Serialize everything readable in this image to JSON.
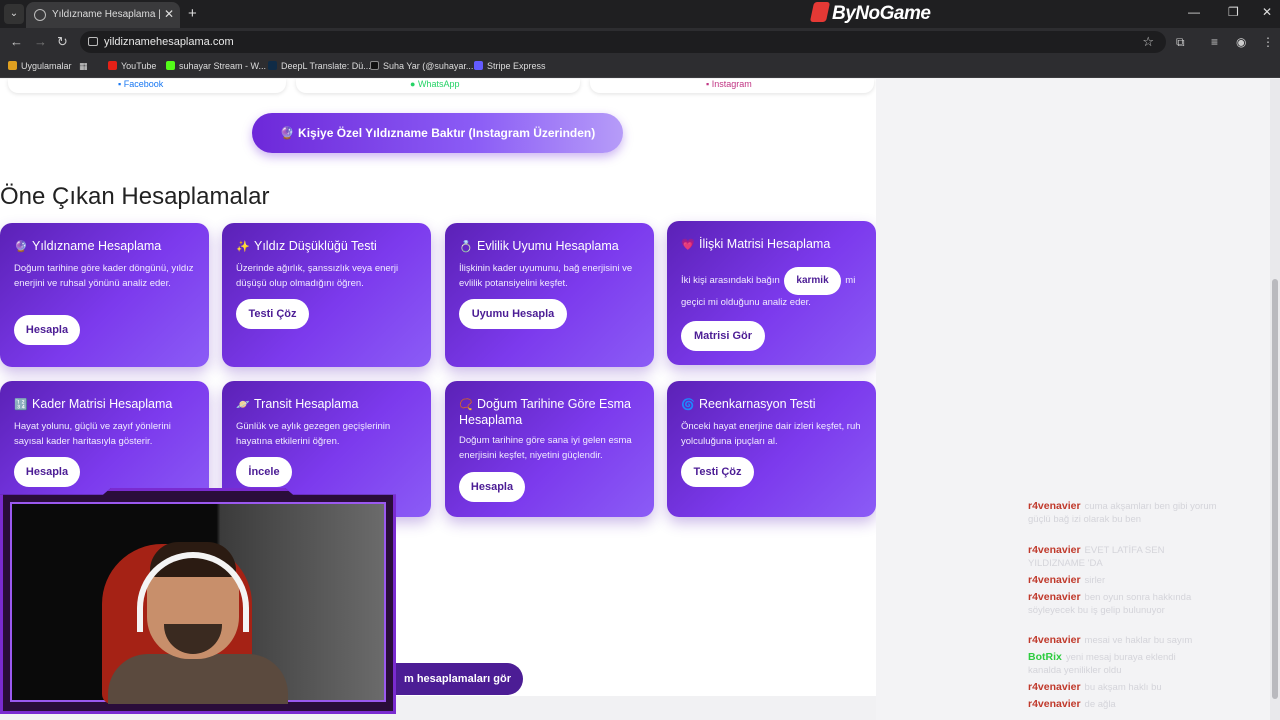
{
  "browser": {
    "tab_title": "Yıldızname Hesaplama | Doğum",
    "tab_close": "✕",
    "new_tab": "+",
    "brand": "ByNoGame",
    "url": "yildiznamehesaplama.com",
    "bookmarks": [
      {
        "label": "Uygulamalar",
        "color": "#e0a020"
      },
      {
        "label": "YouTube",
        "color": "#e62117"
      },
      {
        "label": "suhayar Stream - W...",
        "color": "#53fc18"
      },
      {
        "label": "DeepL Translate: Dü...",
        "color": "#0f2b46"
      },
      {
        "label": "Suha Yar (@suhayar....",
        "color": "#111111"
      },
      {
        "label": "Stripe Express",
        "color": "#635bff"
      }
    ]
  },
  "share": {
    "facebook": "Facebook",
    "whatsapp": "WhatsApp",
    "instagram": "Instagram"
  },
  "cta": {
    "label": "🔮 Kişiye Özel Yıldızname Baktır (Instagram Üzerinden)"
  },
  "section_title": "Öne Çıkan Hesaplamalar",
  "cards": [
    {
      "emoji": "🔮",
      "title": "Yıldızname Hesaplama",
      "desc": "Doğum tarihine göre kader döngünü, yıldız enerjini ve ruhsal yönünü analiz eder.",
      "button": "Hesapla"
    },
    {
      "emoji": "✨",
      "title": "Yıldız Düşüklüğü Testi",
      "desc": "Üzerinde ağırlık, şanssızlık veya enerji düşüşü olup olmadığını öğren.",
      "button": "Testi Çöz"
    },
    {
      "emoji": "💍",
      "title": "Evlilik Uyumu Hesaplama",
      "desc": "İlişkinin kader uyumunu, bağ enerjisini ve evlilik potansiyelini keşfet.",
      "button": "Uyumu Hesapla"
    },
    {
      "emoji": "💗",
      "title": "İlişki Matrisi Hesaplama",
      "desc_before": "İki kişi arasındaki bağın",
      "highlight": "karmik",
      "desc_after": "mi",
      "desc_line2": "geçici mi olduğunu analiz eder.",
      "button": "Matrisi Gör"
    },
    {
      "emoji": "🔢",
      "title": "Kader Matrisi Hesaplama",
      "desc": "Hayat yolunu, güçlü ve zayıf yönlerini sayısal kader haritasıyla gösterir.",
      "button": "Hesapla"
    },
    {
      "emoji": "🪐",
      "title": "Transit Hesaplama",
      "desc": "Günlük ve aylık gezegen geçişlerinin hayatına etkilerini öğren.",
      "button": "İncele"
    },
    {
      "emoji": "📿",
      "title": "Doğum Tarihine Göre Esma Hesaplama",
      "desc": "Doğum tarihine göre sana iyi gelen esma enerjisini keşfet, niyetini güçlendir.",
      "button": "Hesapla"
    },
    {
      "emoji": "🌀",
      "title": "Reenkarnasyon Testi",
      "desc": "Önceki hayat enerjine dair izleri keşfet, ruh yolculuğuna ipuçları al.",
      "button": "Testi Çöz"
    }
  ],
  "all_button": "m hesaplamaları gör",
  "chat": [
    {
      "user": "r4venavier",
      "msg": "cuma akşamları ben gibi yorum",
      "msg2": "güçlü bağ izi olarak bu ben"
    },
    {
      "user": "r4venavier",
      "msg": "EVET LATİFA SEN",
      "msg2": "YILDIZNAME 'DA"
    },
    {
      "user": "r4venavier",
      "msg": "sirler"
    },
    {
      "user": "r4venavier",
      "msg": "ben oyun sonra hakkında",
      "msg2": "söyleyecek bu iş gelip bulunuyor"
    },
    {
      "user": "r4venavier",
      "msg": "mesai ve haklar bu sayım"
    },
    {
      "user": "BotRix",
      "msg": "yeni mesaj buraya eklendi",
      "msg2": "kanalda yenilikler oldu"
    },
    {
      "user": "r4venavier",
      "msg": "bu akşam haklı bu"
    },
    {
      "user": "r4venavier",
      "msg": "de ağla"
    }
  ]
}
